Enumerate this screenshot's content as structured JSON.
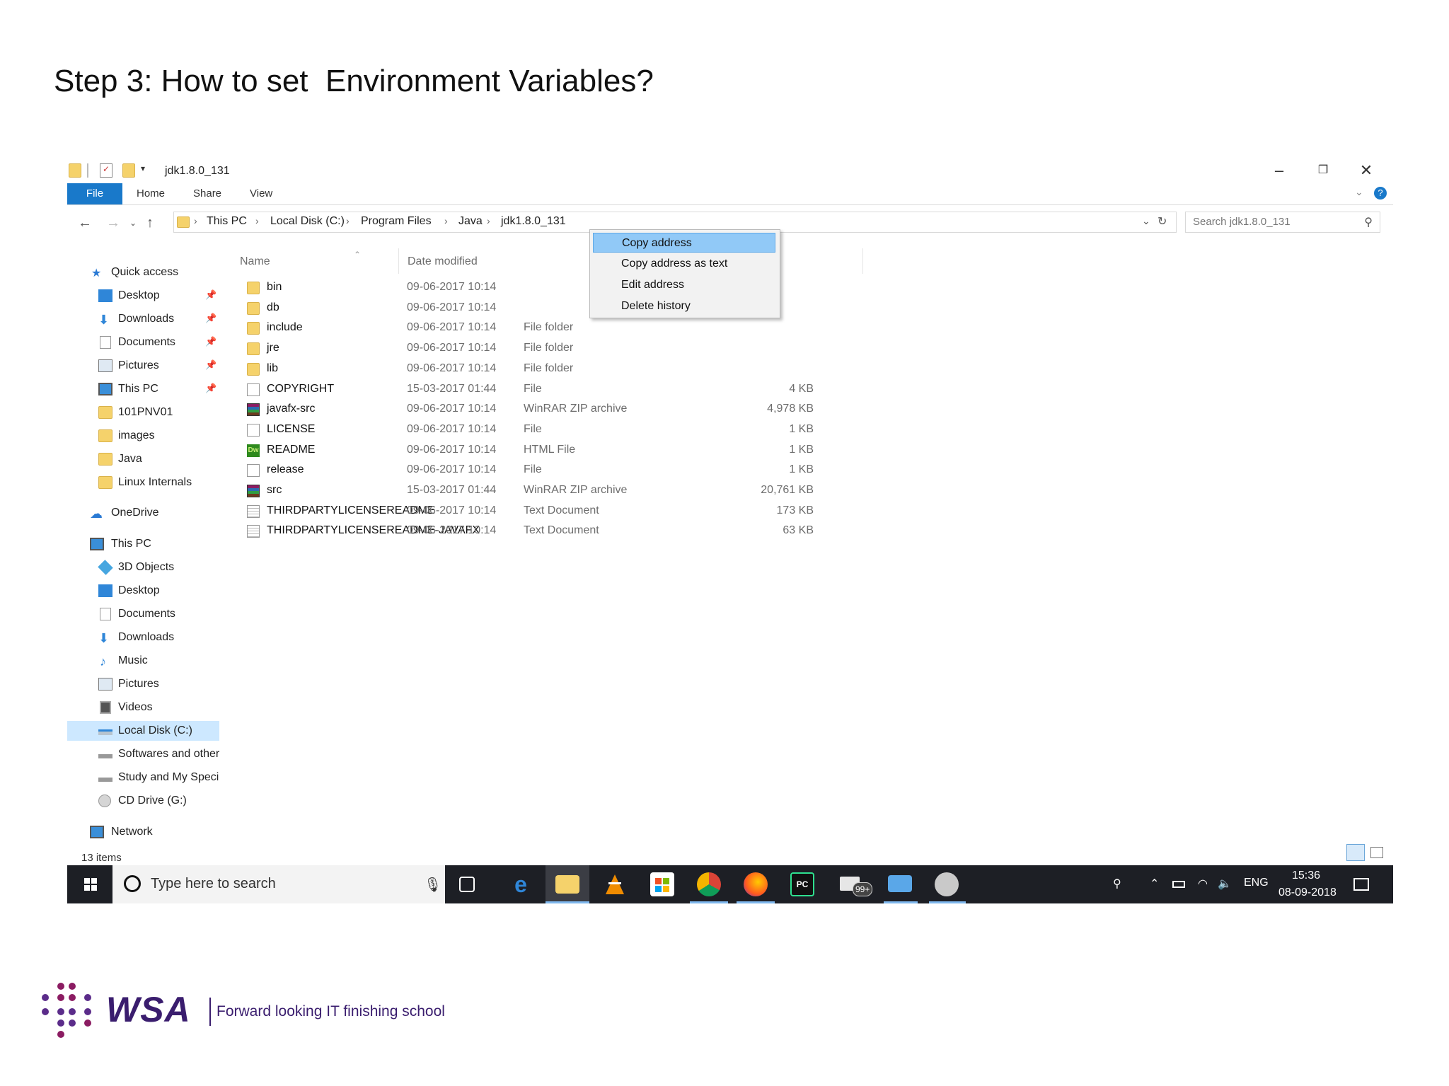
{
  "slide": {
    "title": "Step 3: How to set  Environment Variables?"
  },
  "window": {
    "title": "jdk1.8.0_131",
    "ribbon_tabs": [
      "File",
      "Home",
      "Share",
      "View"
    ],
    "breadcrumb": [
      "This PC",
      "Local Disk (C:)",
      "Program Files",
      "Java",
      "jdk1.8.0_131"
    ],
    "search_placeholder": "Search jdk1.8.0_131",
    "status": "13 items"
  },
  "nav": {
    "quick_access": "Quick access",
    "quick_items": [
      "Desktop",
      "Downloads",
      "Documents",
      "Pictures",
      "This PC",
      "101PNV01",
      "images",
      "Java",
      "Linux Internals"
    ],
    "onedrive": "OneDrive",
    "this_pc": "This PC",
    "pc_items": [
      "3D Objects",
      "Desktop",
      "Documents",
      "Downloads",
      "Music",
      "Pictures",
      "Videos",
      "Local Disk (C:)",
      "Softwares and other",
      "Study and My Speci",
      "CD Drive (G:)"
    ],
    "network": "Network"
  },
  "columns": {
    "name": "Name",
    "date": "Date modified"
  },
  "files": [
    {
      "name": "bin",
      "date": "09-06-2017 10:14",
      "type": "",
      "size": "",
      "icon": "folder-icon"
    },
    {
      "name": "db",
      "date": "09-06-2017 10:14",
      "type": "",
      "size": "",
      "icon": "folder-icon"
    },
    {
      "name": "include",
      "date": "09-06-2017 10:14",
      "type": "File folder",
      "size": "",
      "icon": "folder-icon"
    },
    {
      "name": "jre",
      "date": "09-06-2017 10:14",
      "type": "File folder",
      "size": "",
      "icon": "folder-icon"
    },
    {
      "name": "lib",
      "date": "09-06-2017 10:14",
      "type": "File folder",
      "size": "",
      "icon": "folder-icon"
    },
    {
      "name": "COPYRIGHT",
      "date": "15-03-2017 01:44",
      "type": "File",
      "size": "4 KB",
      "icon": "file-icon"
    },
    {
      "name": "javafx-src",
      "date": "09-06-2017 10:14",
      "type": "WinRAR ZIP archive",
      "size": "4,978 KB",
      "icon": "winrar-icon"
    },
    {
      "name": "LICENSE",
      "date": "09-06-2017 10:14",
      "type": "File",
      "size": "1 KB",
      "icon": "file-icon"
    },
    {
      "name": "README",
      "date": "09-06-2017 10:14",
      "type": "HTML File",
      "size": "1 KB",
      "icon": "dreamweaver-icon"
    },
    {
      "name": "release",
      "date": "09-06-2017 10:14",
      "type": "File",
      "size": "1 KB",
      "icon": "file-icon"
    },
    {
      "name": "src",
      "date": "15-03-2017 01:44",
      "type": "WinRAR ZIP archive",
      "size": "20,761 KB",
      "icon": "winrar-icon"
    },
    {
      "name": "THIRDPARTYLICENSEREADME",
      "date": "09-06-2017 10:14",
      "type": "Text Document",
      "size": "173 KB",
      "icon": "text-doc-icon"
    },
    {
      "name": "THIRDPARTYLICENSEREADME-JAVAFX",
      "date": "09-06-2017 10:14",
      "type": "Text Document",
      "size": "63 KB",
      "icon": "text-doc-icon"
    }
  ],
  "context_menu": [
    "Copy address",
    "Copy address as text",
    "Edit address",
    "Delete history"
  ],
  "taskbar": {
    "search_placeholder": "Type here to search",
    "language": "ENG",
    "time": "15:36",
    "date": "08-09-2018",
    "badge": "99+"
  },
  "footer": {
    "logo": "WSA",
    "tagline": "Forward looking IT finishing school"
  }
}
